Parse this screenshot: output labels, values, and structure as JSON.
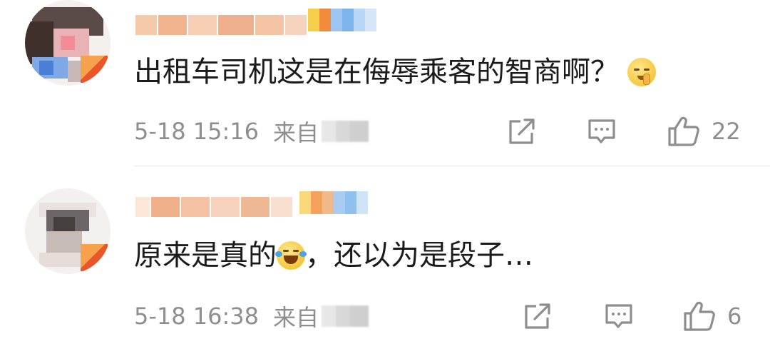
{
  "comments": [
    {
      "text": "出租车司机这是在侮辱乘客的智商啊？",
      "emoji": "shush-face-emoji",
      "time": "5-18 15:16",
      "from_label": "来自",
      "likes": "22"
    },
    {
      "text_before": "原来是真的",
      "emoji": "laughing-crying-emoji",
      "text_after": "，还以为是段子…",
      "time": "5-18 16:38",
      "from_label": "来自",
      "likes": "6"
    }
  ],
  "icons": {
    "share": "share-icon",
    "reply": "comment-icon",
    "like": "thumbs-up-icon"
  },
  "colors": {
    "meta_text": "#8e8e8e",
    "body_text": "#1b1b1b",
    "divider": "#e6e6e6"
  }
}
